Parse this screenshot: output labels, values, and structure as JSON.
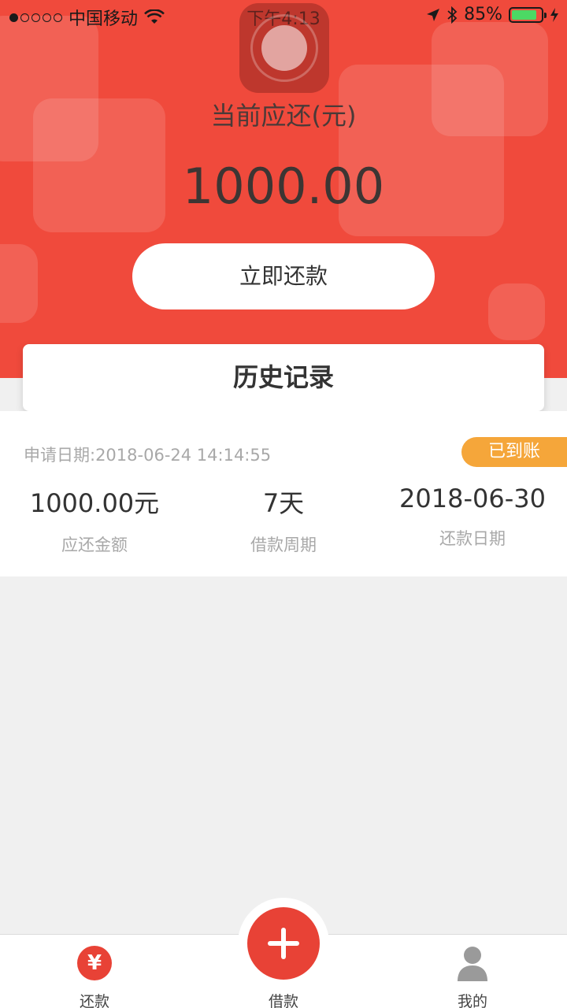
{
  "status_bar": {
    "carrier": "中国移动",
    "time": "下午4:13",
    "battery_percent": "85%",
    "battery_level": 0.85,
    "icons": [
      "signal-dots-icon",
      "wifi-icon",
      "location-arrow-icon",
      "bluetooth-icon",
      "battery-icon",
      "charging-bolt-icon"
    ]
  },
  "header": {
    "due_label": "当前应还(元)",
    "due_amount": "1000.00",
    "repay_button_label": "立即还款"
  },
  "history": {
    "title": "历史记录",
    "records": [
      {
        "apply_date": "申请日期:2018-06-24 14:14:55",
        "status": "已到账",
        "amount": "1000.00元",
        "amount_label": "应还金额",
        "period": "7天",
        "period_label": "借款周期",
        "due_date": "2018-06-30",
        "due_date_label": "还款日期"
      }
    ]
  },
  "tab_bar": {
    "tabs": [
      {
        "label": "还款",
        "icon": "yen-icon"
      },
      {
        "label": "借款",
        "icon": "plus-icon"
      },
      {
        "label": "我的",
        "icon": "user-icon"
      }
    ]
  },
  "colors": {
    "brand_red": "#f04a3c",
    "badge_orange": "#f5a63a",
    "battery_green": "#4cd964"
  }
}
